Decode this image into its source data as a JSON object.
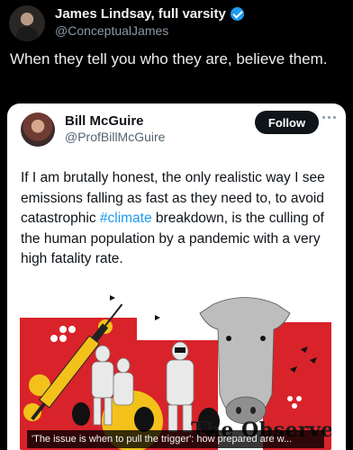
{
  "outer_post": {
    "author_name": "James Lindsay, full varsity",
    "author_handle": "@ConceptualJames",
    "text": "When they tell you who they are, believe them."
  },
  "quoted_post": {
    "author_name": "Bill McGuire",
    "author_handle": "@ProfBillMcGuire",
    "follow_label": "Follow",
    "text_before": "If I am brutally honest, the only realistic way I see emissions falling as fast as they need to, to avoid catastrophic ",
    "hashtag": "#climate",
    "text_after": " breakdown, is the culling of the human population by a pandemic with a very high fatality rate.",
    "media": {
      "caption": "'The issue is when to pull the trigger': how prepared are w...",
      "logo_text": "The Observer"
    }
  },
  "colors": {
    "background": "#000000",
    "card": "#ffffff",
    "verified_badge": "#1d9bf0",
    "hashtag": "#1d9bf0",
    "follow_button": "#0f1419",
    "media_red": "#d8232a",
    "media_yellow": "#f2c21b"
  },
  "icons": {
    "verified": "verified-badge-icon",
    "more": "more-options-icon"
  }
}
